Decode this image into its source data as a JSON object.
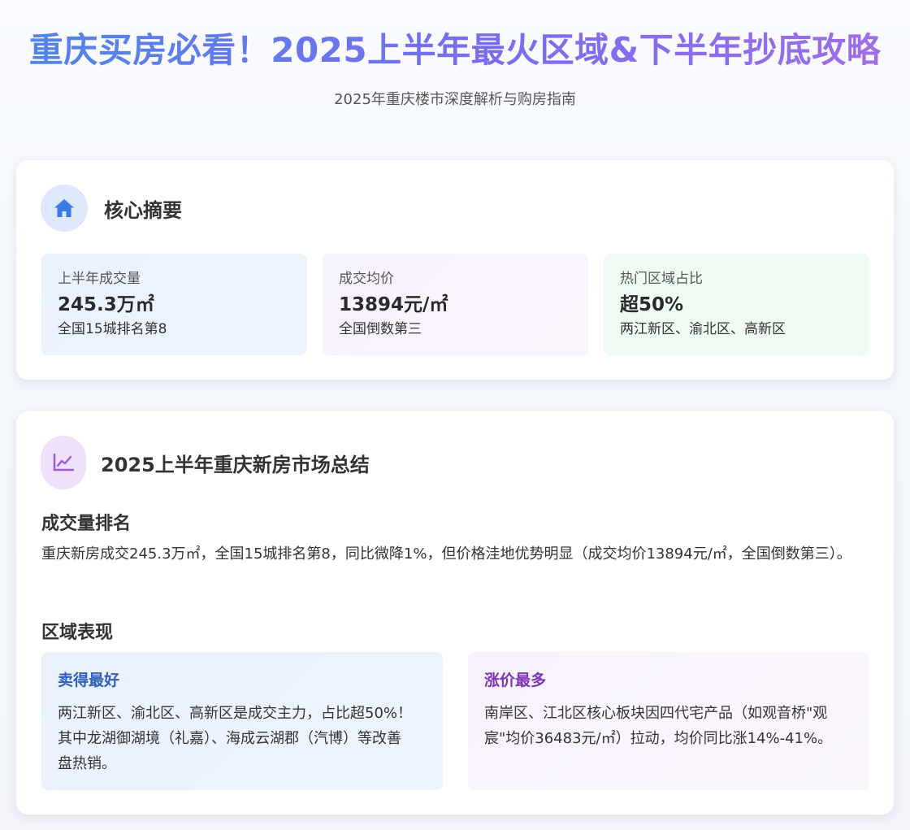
{
  "header": {
    "title": "重庆买房必看！2025上半年最火区域&下半年抄底攻略",
    "subtitle": "2025年重庆楼市深度解析与购房指南"
  },
  "summary": {
    "icon": "home-icon",
    "title": "核心摘要",
    "stats": [
      {
        "label": "上半年成交量",
        "value": "245.3万㎡",
        "note": "全国15城排名第8"
      },
      {
        "label": "成交均价",
        "value": "13894元/㎡",
        "note": "全国倒数第三"
      },
      {
        "label": "热门区域占比",
        "value": "超50%",
        "note": "两江新区、渝北区、高新区"
      }
    ]
  },
  "market": {
    "icon": "line-chart-icon",
    "title": "2025上半年重庆新房市场总结",
    "ranking_heading": "成交量排名",
    "ranking_text": "重庆新房成交245.3万㎡，全国15城排名第8，同比微降1%，但价格洼地优势明显（成交均价13894元/㎡，全国倒数第三）。",
    "region_heading": "区域表现",
    "regions": [
      {
        "title": "卖得最好",
        "body": "两江新区、渝北区、高新区是成交主力，占比超50%！其中龙湖御湖境（礼嘉）、海成云湖郡（汽博）等改善盘热销。"
      },
      {
        "title": "涨价最多",
        "body": "南岸区、江北区核心板块因四代宅产品（如观音桥\"观宸\"均价36483元/㎡）拉动，均价同比涨14%-41%。"
      }
    ]
  },
  "colors": {
    "title_gradient_start": "#4e86e8",
    "title_gradient_end": "#a06ee6",
    "accent_blue": "#2f5fbf",
    "accent_purple": "#7b35b8"
  }
}
